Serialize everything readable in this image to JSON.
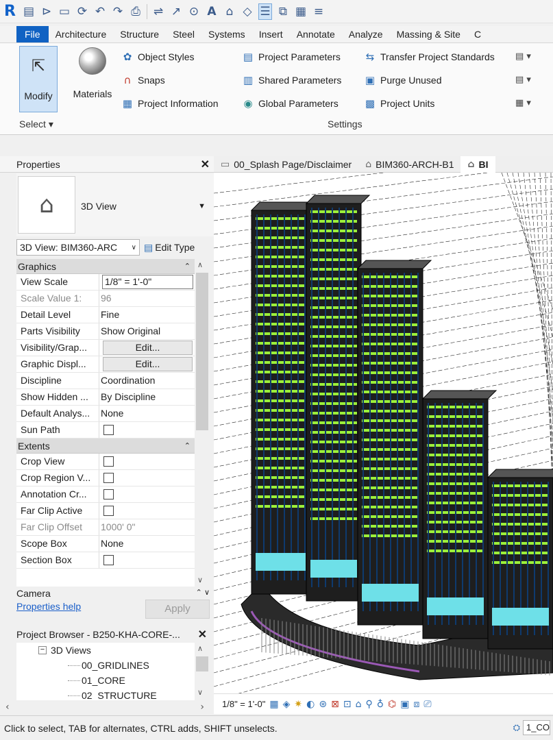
{
  "app": {
    "logo": "R"
  },
  "ribbon_tabs": [
    "File",
    "Architecture",
    "Structure",
    "Steel",
    "Systems",
    "Insert",
    "Annotate",
    "Analyze",
    "Massing & Site",
    "C"
  ],
  "ribbon": {
    "modify_label": "Modify",
    "materials_label": "Materials",
    "object_styles": "Object  Styles",
    "snaps": "Snaps",
    "project_information": "Project  Information",
    "project_parameters": "Project  Parameters",
    "shared_parameters": "Shared  Parameters",
    "global_parameters": "Global  Parameters",
    "transfer_project_standards": "Transfer  Project  Standards",
    "purge_unused": "Purge  Unused",
    "project_units": "Project  Units",
    "select_label": "Select",
    "settings_label": "Settings"
  },
  "properties": {
    "title": "Properties",
    "type_name": "3D View",
    "instance_selector": "3D View: BIM360-ARC",
    "edit_type": "Edit Type",
    "groups": [
      {
        "name": "Graphics",
        "rows": [
          {
            "key": "View Scale",
            "value": "1/8\" = 1'-0\"",
            "kind": "input"
          },
          {
            "key": "Scale Value    1:",
            "value": "96",
            "kind": "grey"
          },
          {
            "key": "Detail Level",
            "value": "Fine",
            "kind": "text"
          },
          {
            "key": "Parts Visibility",
            "value": "Show Original",
            "kind": "text"
          },
          {
            "key": "Visibility/Grap...",
            "value": "Edit...",
            "kind": "button"
          },
          {
            "key": "Graphic Displ...",
            "value": "Edit...",
            "kind": "button"
          },
          {
            "key": "Discipline",
            "value": "Coordination",
            "kind": "text"
          },
          {
            "key": "Show Hidden ...",
            "value": "By Discipline",
            "kind": "text"
          },
          {
            "key": "Default Analys...",
            "value": "None",
            "kind": "text"
          },
          {
            "key": "Sun Path",
            "value": "",
            "kind": "checkbox"
          }
        ]
      },
      {
        "name": "Extents",
        "rows": [
          {
            "key": "Crop View",
            "value": "",
            "kind": "checkbox"
          },
          {
            "key": "Crop Region V...",
            "value": "",
            "kind": "checkbox"
          },
          {
            "key": "Annotation Cr...",
            "value": "",
            "kind": "checkbox"
          },
          {
            "key": "Far Clip Active",
            "value": "",
            "kind": "checkbox"
          },
          {
            "key": "Far Clip Offset",
            "value": "1000'  0\"",
            "kind": "grey"
          },
          {
            "key": "Scope Box",
            "value": "None",
            "kind": "text"
          },
          {
            "key": "Section Box",
            "value": "",
            "kind": "checkbox"
          }
        ]
      }
    ],
    "camera_group": "Camera",
    "help_link": "Properties help",
    "apply_button": "Apply"
  },
  "project_browser": {
    "title": "Project Browser - B250-KHA-CORE-...",
    "items": [
      "3D Views",
      "00_GRIDLINES",
      "01_CORE",
      "02_STRUCTURE"
    ]
  },
  "view_tabs": [
    {
      "label": "00_Splash Page/Disclaimer",
      "active": false
    },
    {
      "label": "BIM360-ARCH-B1",
      "active": false
    },
    {
      "label": "BI",
      "active": true
    }
  ],
  "view_control": {
    "scale": "1/8\" = 1'-0\""
  },
  "status": {
    "text": "Click to select, TAB for alternates, CTRL adds, SHIFT unselects.",
    "workset": "1_CO"
  },
  "colors": {
    "accent": "#1062c3",
    "selected": "#cfe3f7",
    "glazing": "#9cf03a",
    "lobby": "#6ee0e8",
    "edge": "#9b59b6"
  }
}
